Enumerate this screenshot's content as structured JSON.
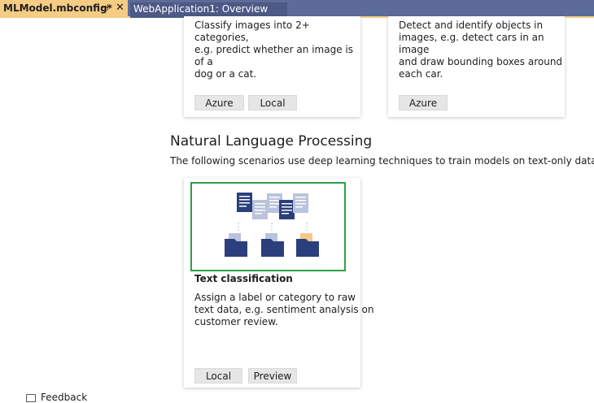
{
  "tabs": [
    {
      "label": "MLModel.mbconfig*",
      "active": true
    },
    {
      "label": "WebApplication1: Overview",
      "active": false
    }
  ],
  "top_cards": [
    {
      "description_lines": [
        "Classify images into 2+ categories,",
        "e.g. predict whether an image is of a",
        "dog or a cat."
      ],
      "buttons": [
        "Azure",
        "Local"
      ]
    },
    {
      "description_lines": [
        "Detect and identify objects in",
        "images, e.g. detect cars in an image",
        "and draw bounding boxes around",
        "each car."
      ],
      "buttons": [
        "Azure"
      ]
    }
  ],
  "nlp_section": {
    "title": "Natural Language Processing",
    "description": "The following scenarios use deep learning techniques to train models on text-only data."
  },
  "text_classification_card": {
    "title": "Text classification",
    "description_lines": [
      "Assign a label or category to raw",
      "text data, e.g. sentiment analysis on",
      "customer review."
    ],
    "buttons": [
      "Local",
      "Preview"
    ]
  },
  "footer": {
    "feedback_label": "Feedback"
  },
  "colors": {
    "tab_bar": "#5d6b99",
    "active_tab": "#f5cc84",
    "selection_border": "#2ea043",
    "illustration_dark": "#2b3f7c",
    "illustration_light": "#b9c3dd",
    "illustration_accent": "#f5c98a"
  }
}
